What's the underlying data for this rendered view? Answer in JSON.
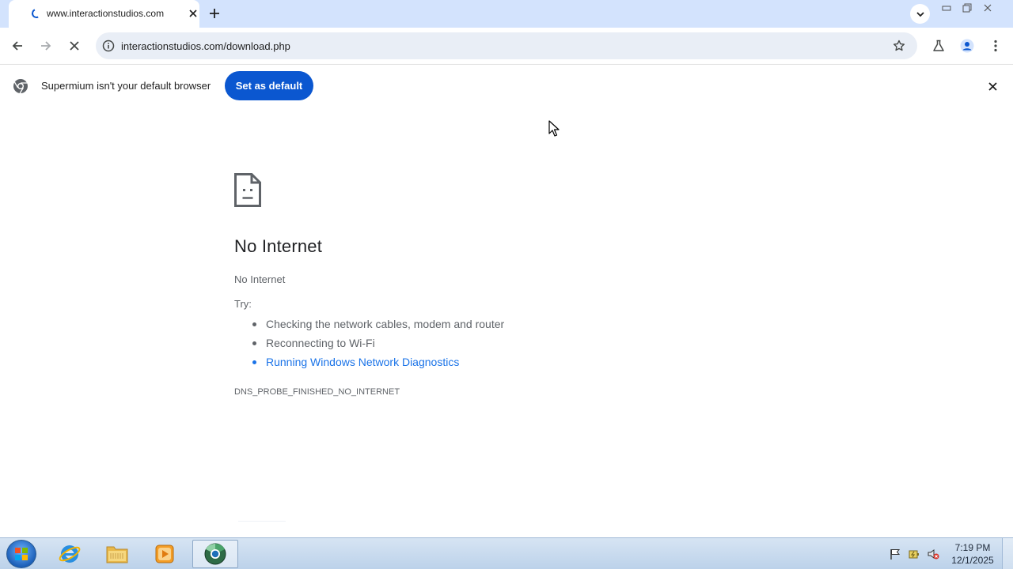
{
  "tab": {
    "title": "www.interactionstudios.com"
  },
  "toolbar": {
    "url": "interactionstudios.com/download.php"
  },
  "infobar": {
    "message": "Supermium isn't your default browser",
    "button_label": "Set as default"
  },
  "error": {
    "title": "No Internet",
    "subtitle": "No Internet",
    "try_label": "Try:",
    "suggestions": [
      "Checking the network cables, modem and router",
      "Reconnecting to Wi-Fi",
      "Running Windows Network Diagnostics"
    ],
    "code": "DNS_PROBE_FINISHED_NO_INTERNET"
  },
  "taskbar": {
    "time": "7:19 PM",
    "date": "12/1/2025",
    "apps": [
      "internet-explorer-icon",
      "file-explorer-icon",
      "media-player-icon",
      "supermium-browser-icon"
    ]
  },
  "colors": {
    "accent": "#0b57d0",
    "link": "#1a73e8",
    "tabstrip": "#d3e3fd"
  }
}
